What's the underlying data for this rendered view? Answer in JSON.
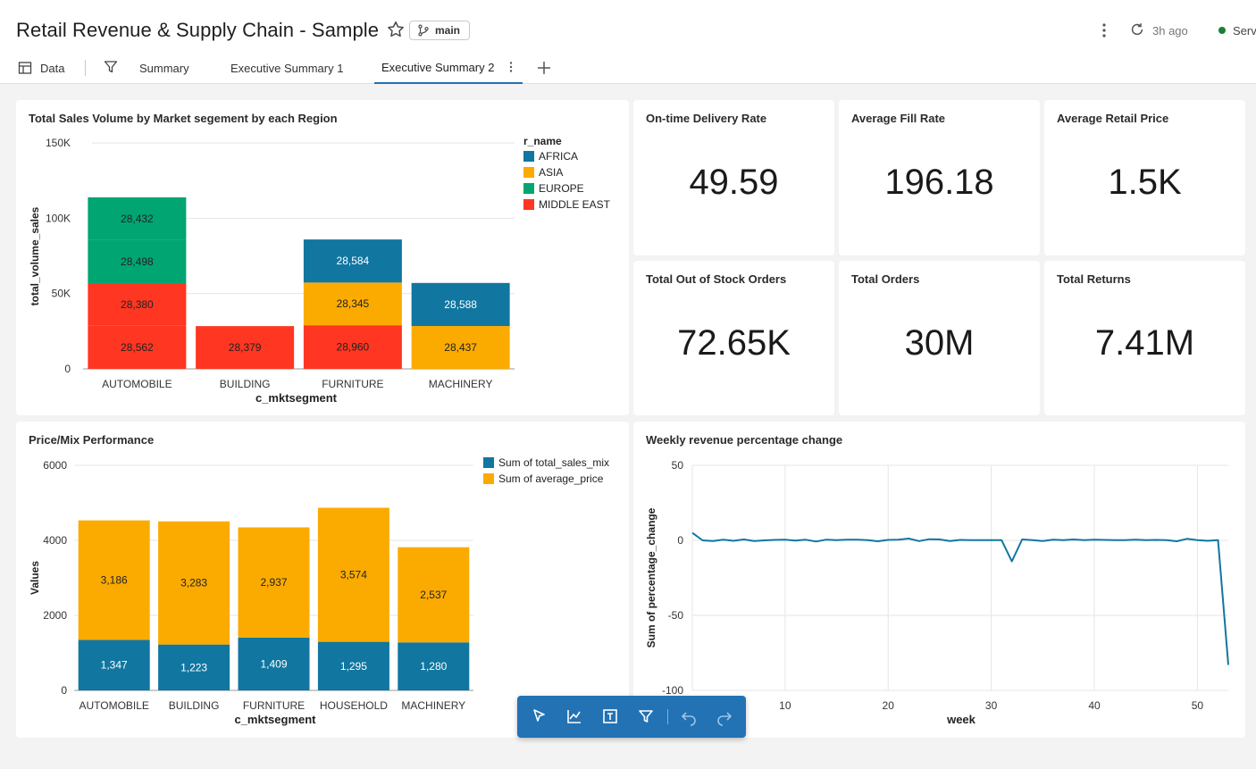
{
  "header": {
    "title": "Retail Revenue & Supply Chain - Sample",
    "branch": "main",
    "updated": "3h ago",
    "status": "Serve"
  },
  "tabs": [
    {
      "label": "Data"
    },
    {
      "label": "Summary"
    },
    {
      "label": "Executive Summary 1"
    },
    {
      "label": "Executive Summary 2",
      "active": true
    }
  ],
  "kpis": [
    {
      "title": "On-time Delivery Rate",
      "value": "49.59"
    },
    {
      "title": "Average Fill Rate",
      "value": "196.18"
    },
    {
      "title": "Average Retail Price",
      "value": "1.5K"
    },
    {
      "title": "Total Out of Stock Orders",
      "value": "72.65K"
    },
    {
      "title": "Total Orders",
      "value": "30M"
    },
    {
      "title": "Total Returns",
      "value": "7.41M"
    }
  ],
  "chart_data": [
    {
      "type": "bar",
      "stacked": true,
      "title": "Total Sales Volume by Market segement by each Region",
      "xlabel": "c_mktsegment",
      "ylabel": "total_volume_sales",
      "ylim": [
        0,
        150000
      ],
      "yticks": [
        "0",
        "50K",
        "100K",
        "150K"
      ],
      "ytick_values": [
        0,
        50000,
        100000,
        150000
      ],
      "legend_title": "r_name",
      "legend_position": "top-right",
      "categories": [
        "AUTOMOBILE",
        "BUILDING",
        "FURNITURE",
        "MACHINERY"
      ],
      "series": [
        {
          "name": "AFRICA",
          "color": "#1176a0",
          "values": [
            null,
            null,
            28584,
            28588
          ]
        },
        {
          "name": "ASIA",
          "color": "#fbab00",
          "values": [
            null,
            null,
            28345,
            28437
          ]
        },
        {
          "name": "EUROPE",
          "color": "#00a572",
          "values": [
            56930,
            null,
            null,
            null
          ]
        },
        {
          "name": "MIDDLE EAST",
          "color": "#ff3621",
          "values": [
            56942,
            28379,
            28960,
            null
          ]
        }
      ],
      "segments": [
        {
          "category": "AUTOMOBILE",
          "series": "MIDDLE EAST",
          "value": 28562,
          "label": "28,562"
        },
        {
          "category": "AUTOMOBILE",
          "series": "MIDDLE EAST",
          "value": 28380,
          "label": "28,380"
        },
        {
          "category": "AUTOMOBILE",
          "series": "EUROPE",
          "value": 28498,
          "label": "28,498"
        },
        {
          "category": "AUTOMOBILE",
          "series": "EUROPE",
          "value": 28432,
          "label": "28,432"
        },
        {
          "category": "BUILDING",
          "series": "MIDDLE EAST",
          "value": 28379,
          "label": "28,379"
        },
        {
          "category": "FURNITURE",
          "series": "MIDDLE EAST",
          "value": 28960,
          "label": "28,960"
        },
        {
          "category": "FURNITURE",
          "series": "ASIA",
          "value": 28345,
          "label": "28,345"
        },
        {
          "category": "FURNITURE",
          "series": "AFRICA",
          "value": 28584,
          "label": "28,584"
        },
        {
          "category": "MACHINERY",
          "series": "ASIA",
          "value": 28437,
          "label": "28,437"
        },
        {
          "category": "MACHINERY",
          "series": "AFRICA",
          "value": 28588,
          "label": "28,588"
        }
      ],
      "grid": true
    },
    {
      "type": "bar",
      "stacked": true,
      "title": "Price/Mix Performance",
      "xlabel": "c_mktsegment",
      "ylabel": "Values",
      "ylim": [
        0,
        6000
      ],
      "yticks": [
        "0",
        "2000",
        "4000",
        "6000"
      ],
      "ytick_values": [
        0,
        2000,
        4000,
        6000
      ],
      "legend_position": "top-right",
      "categories": [
        "AUTOMOBILE",
        "BUILDING",
        "FURNITURE",
        "HOUSEHOLD",
        "MACHINERY"
      ],
      "series": [
        {
          "name": "Sum of total_sales_mix",
          "color": "#1176a0",
          "values": [
            1347,
            1223,
            1409,
            1295,
            1280
          ],
          "labels": [
            "1,347",
            "1,223",
            "1,409",
            "1,295",
            "1,280"
          ]
        },
        {
          "name": "Sum of average_price",
          "color": "#fbab00",
          "values": [
            3186,
            3283,
            2937,
            3574,
            2537
          ],
          "labels": [
            "3,186",
            "3,283",
            "2,937",
            "3,574",
            "2,537"
          ]
        }
      ],
      "grid": true
    },
    {
      "type": "line",
      "title": "Weekly revenue percentage change",
      "xlabel": "week",
      "ylabel": "Sum of percentage_change",
      "ylim": [
        -100,
        50
      ],
      "xlim": [
        1,
        53
      ],
      "xticks": [
        "10",
        "20",
        "30",
        "40",
        "50"
      ],
      "xtick_values": [
        10,
        20,
        30,
        40,
        50
      ],
      "yticks": [
        "-100",
        "-50",
        "0",
        "50"
      ],
      "ytick_values": [
        -100,
        -50,
        0,
        50
      ],
      "series": [
        {
          "color": "#1176a0",
          "x": [
            1,
            2,
            3,
            4,
            5,
            6,
            7,
            8,
            9,
            10,
            11,
            12,
            13,
            14,
            15,
            16,
            17,
            18,
            19,
            20,
            21,
            22,
            23,
            24,
            25,
            26,
            27,
            28,
            29,
            30,
            31,
            32,
            33,
            34,
            35,
            36,
            37,
            38,
            39,
            40,
            41,
            42,
            43,
            44,
            45,
            46,
            47,
            48,
            49,
            50,
            51,
            52,
            53
          ],
          "y": [
            5,
            0,
            -0.5,
            0.5,
            -0.3,
            0.6,
            -0.4,
            0,
            0.3,
            0.5,
            -0.2,
            0.4,
            -0.8,
            0.5,
            0.2,
            0.4,
            0.5,
            0.1,
            -0.6,
            0.3,
            0.4,
            1.2,
            -0.5,
            0.8,
            0.6,
            -0.4,
            0.3,
            0.2,
            0.2,
            0.2,
            0.1,
            -14,
            0.6,
            0.2,
            -0.5,
            0.5,
            0.2,
            0.6,
            0.1,
            0.4,
            0.3,
            0.1,
            0.2,
            0.4,
            0.1,
            0.3,
            0.2,
            -0.6,
            1.0,
            0.1,
            -0.3,
            0.2,
            -83
          ]
        }
      ],
      "grid": true
    }
  ],
  "toolbar": {
    "icons": [
      "pointer-icon",
      "line-chart-icon",
      "text-box-icon",
      "filter-icon",
      "undo-icon",
      "redo-icon"
    ]
  }
}
